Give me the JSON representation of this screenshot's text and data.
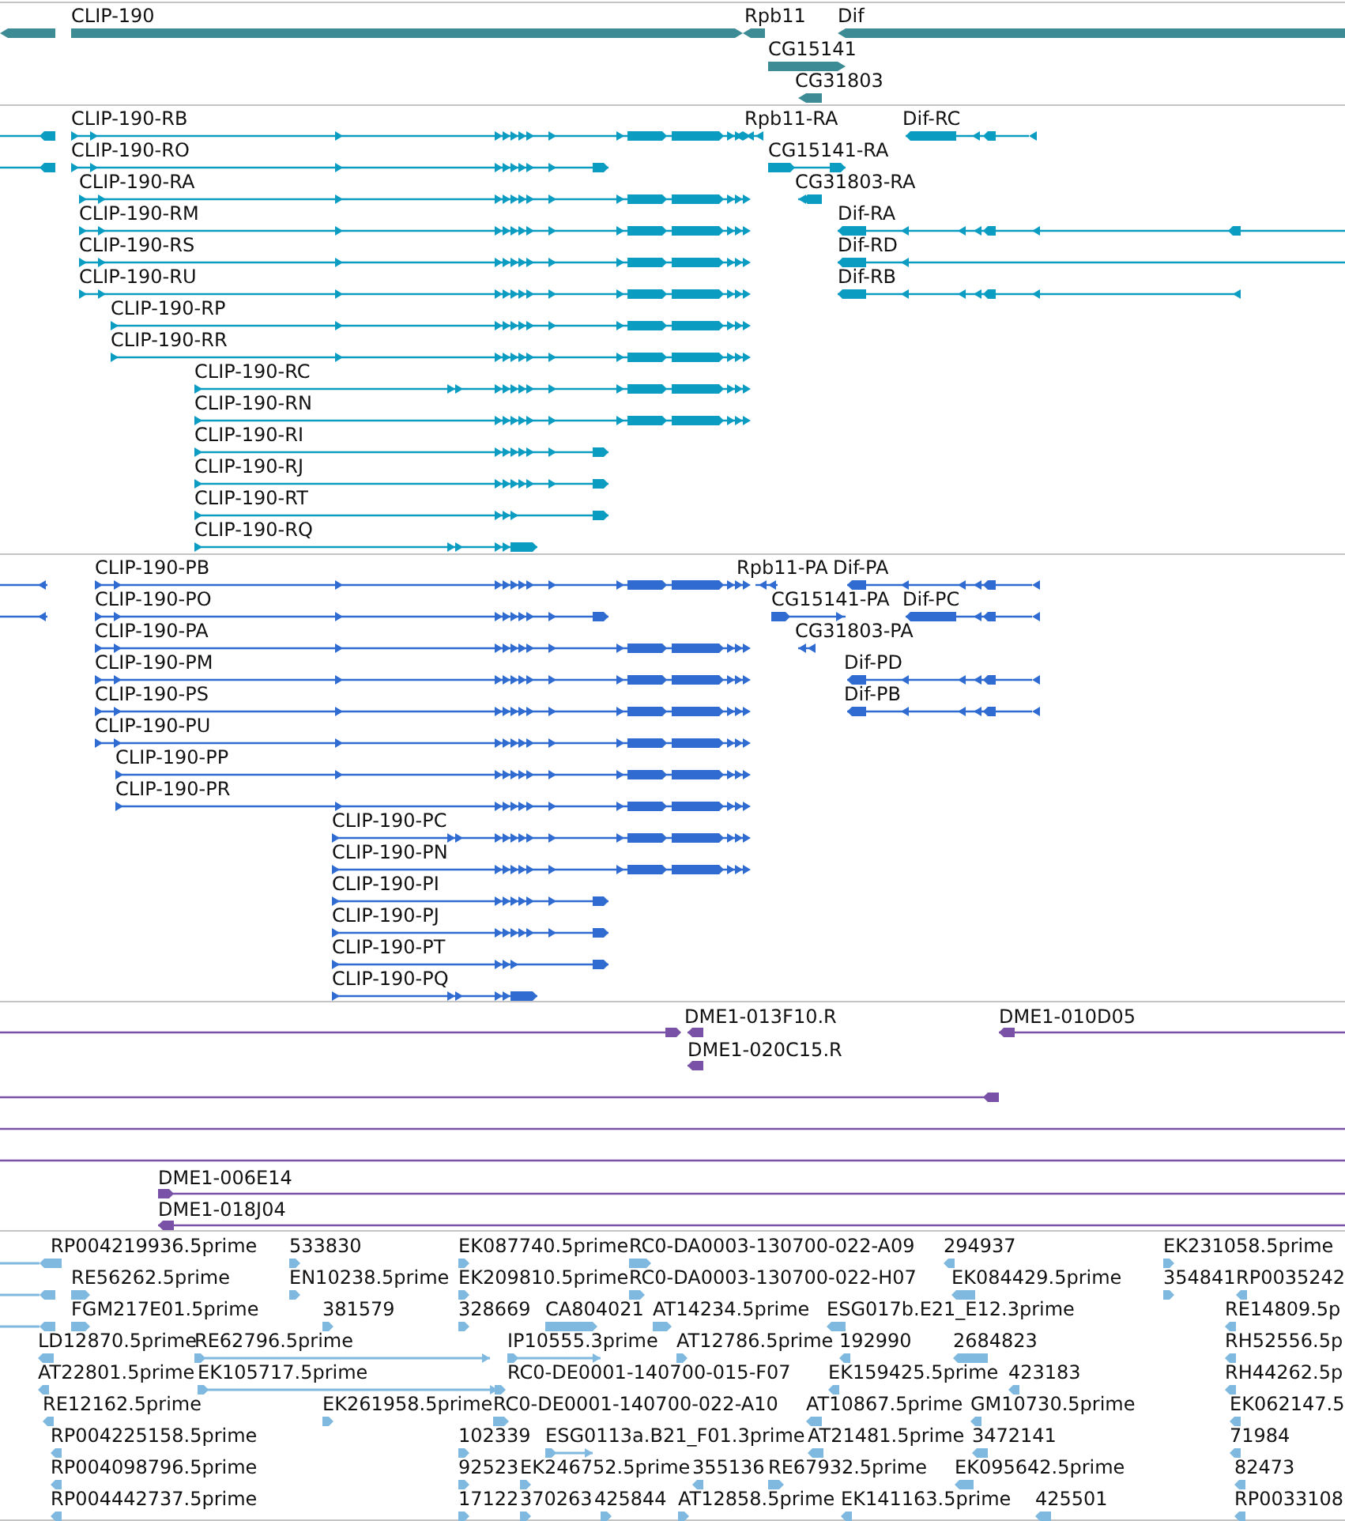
{
  "tracks": [
    {
      "kind": "gene",
      "color": "#3d8c95",
      "features": [
        {
          "reverse": true
        },
        {
          "label": "CLIP-190",
          "reverse": false
        },
        {
          "label": "Rpb11",
          "reverse": true
        },
        {
          "label": "Dif",
          "reverse": true
        },
        {
          "label": "CG15141",
          "reverse": false
        },
        {
          "label": "CG31803",
          "reverse": true
        }
      ]
    },
    {
      "kind": "transcript",
      "color": "#0b9cc2",
      "features": [
        {
          "reverse": true
        },
        {
          "label": "CLIP-190-RB",
          "reverse": false
        },
        {
          "label": "Rpb11-RA",
          "reverse": true
        },
        {
          "label": "Dif-RC",
          "reverse": true
        },
        {
          "reverse": true
        },
        {
          "label": "CLIP-190-RO",
          "reverse": false
        },
        {
          "label": "CG15141-RA",
          "reverse": false
        },
        {
          "label": "CLIP-190-RA",
          "reverse": false
        },
        {
          "label": "CG31803-RA",
          "reverse": true
        },
        {
          "label": "CLIP-190-RM",
          "reverse": false
        },
        {
          "label": "Dif-RA",
          "reverse": true
        },
        {
          "label": "CLIP-190-RS",
          "reverse": false
        },
        {
          "label": "Dif-RD",
          "reverse": true
        },
        {
          "label": "CLIP-190-RU",
          "reverse": false
        },
        {
          "label": "Dif-RB",
          "reverse": true
        },
        {
          "label": "CLIP-190-RP",
          "reverse": false
        },
        {
          "label": "CLIP-190-RR",
          "reverse": false
        },
        {
          "label": "CLIP-190-RC",
          "reverse": false
        },
        {
          "label": "CLIP-190-RN",
          "reverse": false
        },
        {
          "label": "CLIP-190-RI",
          "reverse": false
        },
        {
          "label": "CLIP-190-RJ",
          "reverse": false
        },
        {
          "label": "CLIP-190-RT",
          "reverse": false
        },
        {
          "label": "CLIP-190-RQ",
          "reverse": false
        }
      ]
    },
    {
      "kind": "protein",
      "color": "#2f6bd1",
      "features": [
        {
          "reverse": true
        },
        {
          "label": "CLIP-190-PB",
          "reverse": false
        },
        {
          "label": "Rpb11-PA",
          "reverse": true
        },
        {
          "label": "Dif-PA",
          "reverse": true
        },
        {
          "reverse": true
        },
        {
          "label": "CLIP-190-PO",
          "reverse": false
        },
        {
          "label": "CG15141-PA",
          "reverse": false
        },
        {
          "label": "Dif-PC",
          "reverse": true
        },
        {
          "label": "CLIP-190-PA",
          "reverse": false
        },
        {
          "label": "CG31803-PA",
          "reverse": true
        },
        {
          "label": "CLIP-190-PM",
          "reverse": false
        },
        {
          "label": "Dif-PD",
          "reverse": true
        },
        {
          "label": "CLIP-190-PS",
          "reverse": false
        },
        {
          "label": "Dif-PB",
          "reverse": true
        },
        {
          "label": "CLIP-190-PU",
          "reverse": false
        },
        {
          "label": "CLIP-190-PP",
          "reverse": false
        },
        {
          "label": "CLIP-190-PR",
          "reverse": false
        },
        {
          "label": "CLIP-190-PC",
          "reverse": false
        },
        {
          "label": "CLIP-190-PN",
          "reverse": false
        },
        {
          "label": "CLIP-190-PI",
          "reverse": false
        },
        {
          "label": "CLIP-190-PJ",
          "reverse": false
        },
        {
          "label": "CLIP-190-PT",
          "reverse": false
        },
        {
          "label": "CLIP-190-PQ",
          "reverse": false
        }
      ]
    },
    {
      "kind": "clone",
      "color": "#7952a8",
      "features": [
        {
          "kind": "clone",
          "reverse": false
        },
        {
          "kind": "clone",
          "label": "DME1-013F10.R",
          "reverse": true
        },
        {
          "kind": "clone",
          "label": "DME1-010D05",
          "reverse": true
        },
        {
          "kind": "clone",
          "label": "DME1-020C15.R",
          "reverse": true
        },
        {
          "kind": "clone",
          "reverse": true
        },
        {
          "kind": "span"
        },
        {
          "kind": "span"
        },
        {
          "kind": "clone",
          "label": "DME1-006E14",
          "reverse": false
        },
        {
          "kind": "clone",
          "label": "DME1-018J04",
          "reverse": true
        }
      ]
    },
    {
      "kind": "est",
      "color": "#80b9e0",
      "features": [
        {
          "reverse": true
        },
        {
          "label": "RP004219936.5prime",
          "reverse": true
        },
        {
          "label": "533830",
          "reverse": false
        },
        {
          "label": "EK087740.5prime",
          "reverse": false
        },
        {
          "label": "RC0-DA0003-130700-022-A09",
          "reverse": false
        },
        {
          "label": "294937",
          "reverse": true
        },
        {
          "label": "EK231058.5prime",
          "reverse": false
        },
        {
          "reverse": true
        },
        {
          "label": "RE56262.5prime",
          "reverse": false
        },
        {
          "label": "EN10238.5prime",
          "reverse": false
        },
        {
          "label": "EK209810.5prime",
          "reverse": false
        },
        {
          "label": "RC0-DA0003-130700-022-H07",
          "reverse": false
        },
        {
          "label": "EK084429.5prime",
          "reverse": true
        },
        {
          "label": "354841",
          "reverse": false
        },
        {
          "label": "RP0035242",
          "reverse": true
        },
        {
          "reverse": true
        },
        {
          "label": "FGM217E01.5prime",
          "reverse": false
        },
        {
          "label": "381579",
          "reverse": false
        },
        {
          "label": "328669",
          "reverse": false
        },
        {
          "label": "CA804021",
          "reverse": false
        },
        {
          "label": "AT14234.5prime",
          "reverse": false
        },
        {
          "label": "ESG017b.E21_E12.3prime",
          "reverse": true
        },
        {
          "label": "RE14809.5p",
          "reverse": true
        },
        {
          "label": "LD12870.5prime",
          "reverse": true
        },
        {
          "label": "RE62796.5prime",
          "reverse": false
        },
        {
          "label": "IP10555.3prime",
          "reverse": false
        },
        {
          "label": "AT12786.5prime",
          "reverse": false
        },
        {
          "label": "192990",
          "reverse": true
        },
        {
          "label": "2684823",
          "reverse": true
        },
        {
          "label": "RH52556.5p",
          "reverse": true
        },
        {
          "label": "AT22801.5prime",
          "reverse": true
        },
        {
          "label": "EK105717.5prime",
          "reverse": false
        },
        {
          "label": "RC0-DE0001-140700-015-F07",
          "reverse": false
        },
        {
          "label": "EK159425.5prime",
          "reverse": true
        },
        {
          "label": "423183",
          "reverse": true
        },
        {
          "label": "RH44262.5p",
          "reverse": true
        },
        {
          "label": "RE12162.5prime",
          "reverse": true
        },
        {
          "label": "EK261958.5prime",
          "reverse": false
        },
        {
          "label": "RC0-DE0001-140700-022-A10",
          "reverse": false
        },
        {
          "label": "AT10867.5prime",
          "reverse": true
        },
        {
          "label": "GM10730.5prime",
          "reverse": true
        },
        {
          "label": "EK062147.5",
          "reverse": true
        },
        {
          "label": "RP004225158.5prime",
          "reverse": true
        },
        {
          "label": "102339",
          "reverse": false
        },
        {
          "label": "ESG0113a.B21_F01.3prime",
          "reverse": false
        },
        {
          "label": "AT21481.5prime",
          "reverse": true
        },
        {
          "label": "3472141",
          "reverse": true
        },
        {
          "label": "71984",
          "reverse": true
        },
        {
          "label": "RP004098796.5prime",
          "reverse": true
        },
        {
          "label": "92523",
          "reverse": false
        },
        {
          "label": "EK246752.5prime",
          "reverse": false
        },
        {
          "label": "355136",
          "reverse": true
        },
        {
          "label": "RE67932.5prime",
          "reverse": false
        },
        {
          "label": "EK095642.5prime",
          "reverse": true
        },
        {
          "label": "82473",
          "reverse": true
        },
        {
          "label": "RP004442737.5prime",
          "reverse": true
        },
        {
          "label": "17122",
          "reverse": false
        },
        {
          "label": "370263",
          "reverse": false
        },
        {
          "label": "425844",
          "reverse": false
        },
        {
          "label": "AT12858.5prime",
          "reverse": false
        },
        {
          "label": "EK141163.5prime",
          "reverse": true
        },
        {
          "label": "425501",
          "reverse": true
        },
        {
          "label": "RP0033108",
          "reverse": true
        }
      ]
    }
  ]
}
